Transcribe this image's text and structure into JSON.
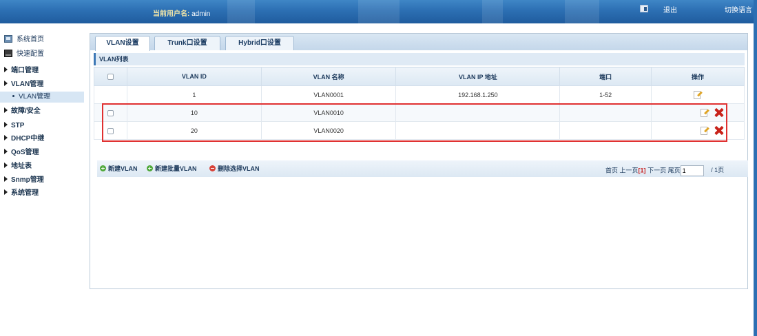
{
  "header": {
    "user_label": "当前用户名:",
    "user_name": "admin",
    "logout": "退出",
    "switch_language": "切换语言"
  },
  "sidebar": {
    "items": [
      {
        "label": "系统首页"
      },
      {
        "label": "快速配置"
      },
      {
        "label": "端口管理"
      },
      {
        "label": "VLAN管理"
      },
      {
        "label": "VLAN管理"
      },
      {
        "label": "故障/安全"
      },
      {
        "label": "STP"
      },
      {
        "label": "DHCP中继"
      },
      {
        "label": "QoS管理"
      },
      {
        "label": "地址表"
      },
      {
        "label": "Snmp管理"
      },
      {
        "label": "系统管理"
      }
    ]
  },
  "tabs": [
    {
      "label": "VLAN设置"
    },
    {
      "label": "Trunk口设置"
    },
    {
      "label": "Hybrid口设置"
    }
  ],
  "panel": {
    "title": "VLAN列表",
    "columns": [
      "VLAN ID",
      "VLAN 名称",
      "VLAN IP 地址",
      "端口",
      "操作"
    ],
    "rows": [
      {
        "id": "1",
        "name": "VLAN0001",
        "ip": "192.168.1.250",
        "ports": "1-52"
      },
      {
        "id": "10",
        "name": "VLAN0010",
        "ip": "",
        "ports": ""
      },
      {
        "id": "20",
        "name": "VLAN0020",
        "ip": "",
        "ports": ""
      }
    ]
  },
  "actions": {
    "new_vlan": "新建VLAN",
    "new_batch_vlan": "新建批量VLAN",
    "delete_selected": "删除选择VLAN"
  },
  "pager": {
    "first": "首页",
    "prev": "上一页",
    "current": "[1]",
    "next": "下一页",
    "last": "尾页",
    "input_value": "1",
    "total": "/ 1页"
  }
}
